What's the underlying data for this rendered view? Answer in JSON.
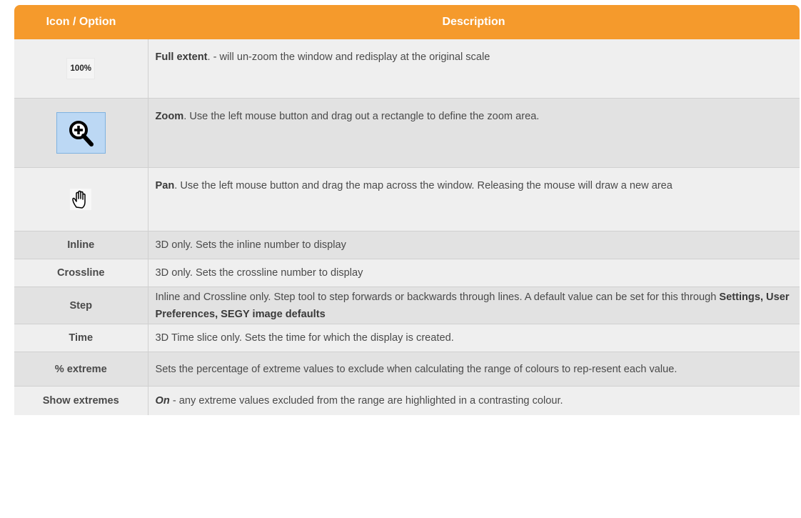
{
  "header": {
    "col1": "Icon / Option",
    "col2": "Description"
  },
  "rows": [
    {
      "option": "100%",
      "bold_term": "Full extent",
      "text": ". - will un-zoom the window and redisplay at the original scale"
    },
    {
      "option": "zoom-icon",
      "bold_term": "Zoom",
      "text": ". Use the left mouse button and drag out a rectangle to define the zoom area."
    },
    {
      "option": "pan-icon",
      "bold_term": "Pan",
      "text": ". Use the left mouse button and drag the map across the window. Releasing the mouse will draw a new area"
    },
    {
      "option": "Inline",
      "text": "3D only. Sets the inline number to display"
    },
    {
      "option": "Crossline",
      "text": "3D only. Sets the crossline number to display"
    },
    {
      "option": "Step",
      "text": "Inline and Crossline only. Step tool to step forwards or backwards through lines. A default value can be set for this through ",
      "bold_tail": "Settings, User Preferences, SEGY image defaults"
    },
    {
      "option": "Time",
      "text": "3D Time slice only. Sets the time for which the display is created."
    },
    {
      "option": "% extreme",
      "text": "Sets the percentage of extreme values to exclude when calculating the range of colours to rep-resent each value."
    },
    {
      "option": "Show extremes",
      "italic_term": "On",
      "text": " - any extreme values excluded from the range are highlighted in a contrasting colour."
    }
  ],
  "colors": {
    "header_bg": "#f59a2c",
    "row_light": "#efefef",
    "row_dark": "#e2e2e2",
    "zoom_icon_bg": "#bcd8f4"
  }
}
